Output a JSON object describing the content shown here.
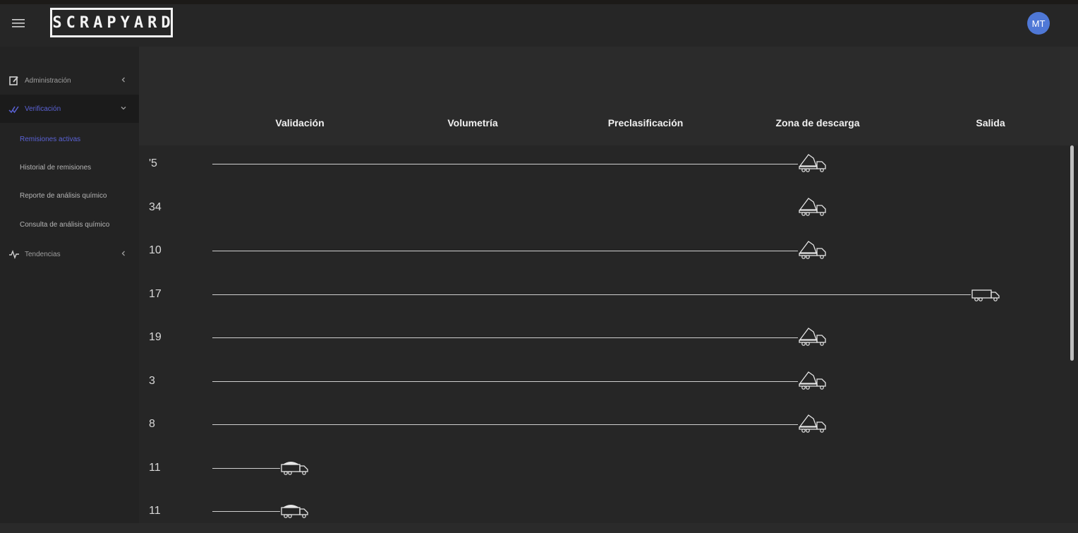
{
  "app": {
    "logo": "SCRAPYARD",
    "user_initials": "MT"
  },
  "sidebar": {
    "items": [
      {
        "label": "Administración",
        "icon": "edit-icon"
      },
      {
        "label": "Verificación",
        "icon": "checks-icon",
        "active": true
      },
      {
        "label": "Tendencias",
        "icon": "pulse-icon"
      }
    ],
    "sub_items": [
      {
        "label": "Remisiones activas",
        "active": true
      },
      {
        "label": "Historial de remisiones"
      },
      {
        "label": "Reporte de análisis químico"
      },
      {
        "label": "Consulta de análisis químico"
      }
    ]
  },
  "board": {
    "columns": [
      "Validación",
      "Volumetría",
      "Preclasificación",
      "Zona de descarga",
      "Salida"
    ],
    "rows": [
      {
        "id": "'5",
        "stage": 3,
        "truck": "dump-truck-icon"
      },
      {
        "id": "34",
        "stage": 3,
        "truck": "dump-truck-icon",
        "no_track": true
      },
      {
        "id": "10",
        "stage": 3,
        "truck": "dump-truck-icon"
      },
      {
        "id": "17",
        "stage": 4,
        "truck": "flatbed-truck-icon"
      },
      {
        "id": "19",
        "stage": 3,
        "truck": "dump-truck-icon"
      },
      {
        "id": "3",
        "stage": 3,
        "truck": "dump-truck-icon"
      },
      {
        "id": "8",
        "stage": 3,
        "truck": "dump-truck-icon"
      },
      {
        "id": "11",
        "stage": 0,
        "truck": "loaded-truck-icon"
      },
      {
        "id": "11",
        "stage": 0,
        "truck": "loaded-truck-icon"
      }
    ]
  },
  "colors": {
    "accent": "#5a62d4",
    "avatar": "#4f78d6"
  }
}
